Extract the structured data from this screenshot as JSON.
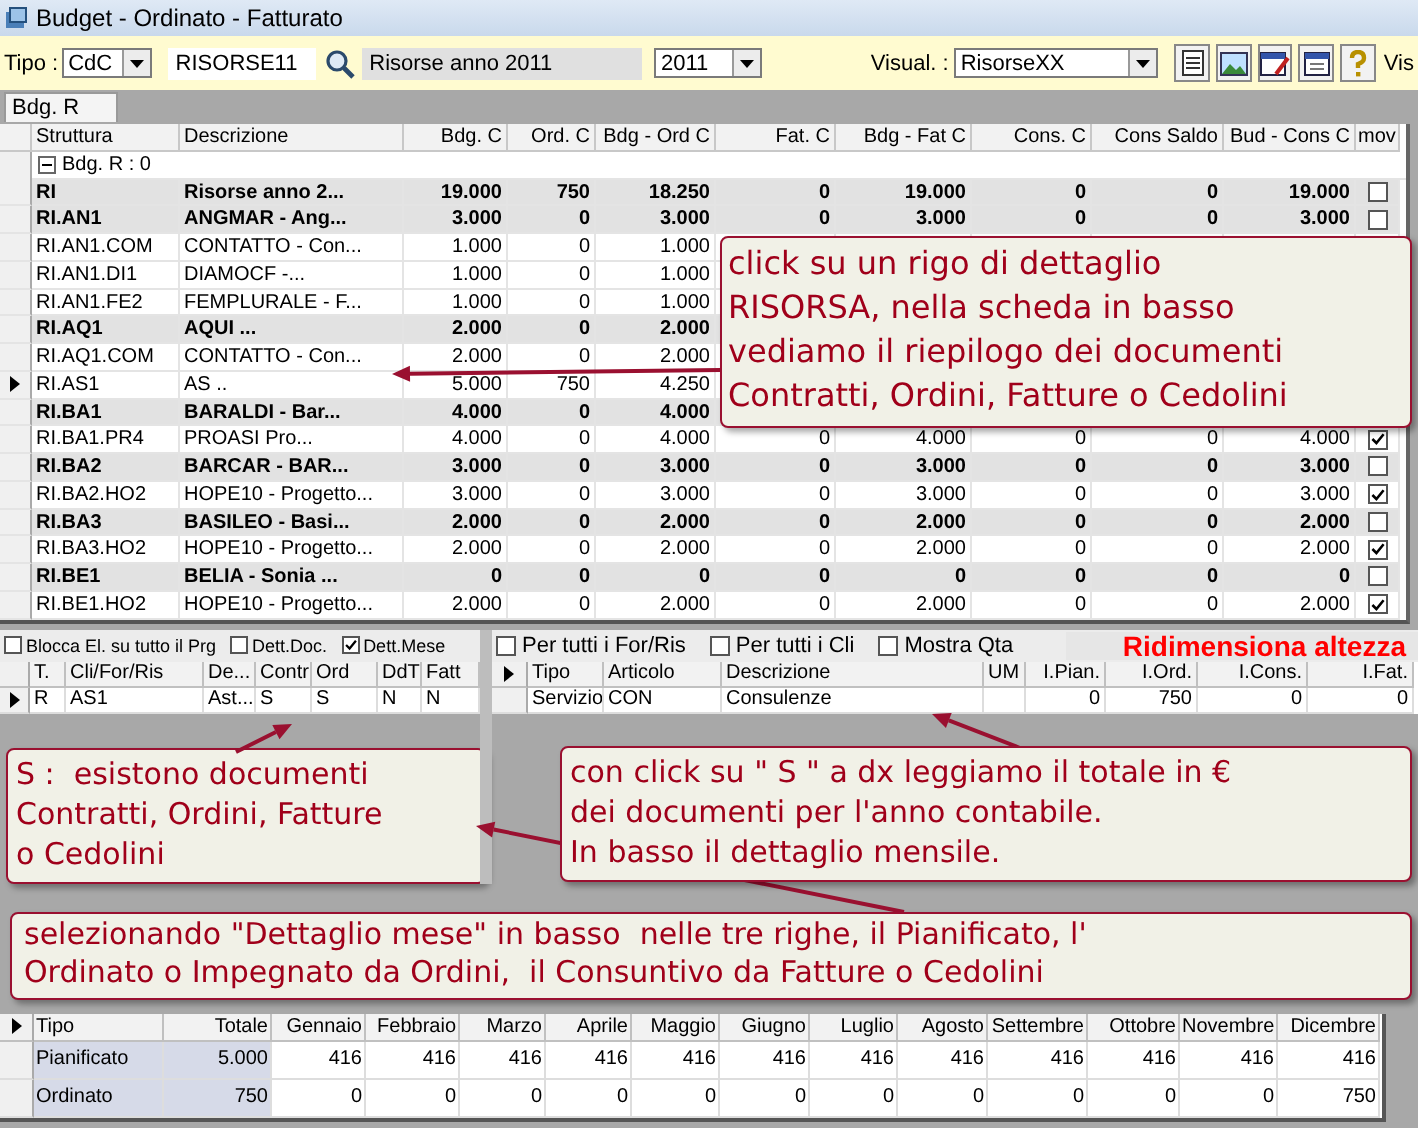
{
  "window": {
    "title": "Budget - Ordinato - Fatturato"
  },
  "toolbar": {
    "tipo_label": "Tipo :",
    "tipo": "CdC",
    "code": "RISORSE11",
    "description": "Risorse anno 2011",
    "year": "2011",
    "visual_label": "Visual. :",
    "visual": "RisorseXX",
    "cut_label": "Vis"
  },
  "tabs": [
    {
      "label": "Bdg. R",
      "selected": true
    }
  ],
  "grid": {
    "columns": [
      "Struttura",
      "Descrizione",
      "Bdg. C",
      "Ord. C",
      "Bdg - Ord C",
      "Fat. C",
      "Bdg - Fat C",
      "Cons. C",
      "Cons Saldo",
      "Bud - Cons C",
      "mov"
    ],
    "group": {
      "label": "Bdg. R : 0",
      "expanded": true
    },
    "rows": [
      {
        "kind": "group",
        "selected": false,
        "code": "RI",
        "description": "Risorse anno 2...",
        "values": [
          "19.000",
          "750",
          "18.250",
          "0",
          "19.000",
          "0",
          "0",
          "19.000"
        ],
        "mov": false
      },
      {
        "kind": "group",
        "selected": false,
        "code": "RI.AN1",
        "description": "ANGMAR - Ang...",
        "values": [
          "3.000",
          "0",
          "3.000",
          "0",
          "3.000",
          "0",
          "0",
          "3.000"
        ],
        "mov": false
      },
      {
        "kind": "detail",
        "selected": false,
        "code": "RI.AN1.COM",
        "description": "CONTATTO - Con...",
        "values": [
          "1.000",
          "0",
          "1.000"
        ]
      },
      {
        "kind": "detail",
        "selected": false,
        "code": "RI.AN1.DI1",
        "description": "DIAMOCF -...",
        "values": [
          "1.000",
          "0",
          "1.000"
        ]
      },
      {
        "kind": "detail",
        "selected": false,
        "code": "RI.AN1.FE2",
        "description": "FEMPLURALE - F...",
        "values": [
          "1.000",
          "0",
          "1.000"
        ]
      },
      {
        "kind": "group",
        "selected": false,
        "code": "RI.AQ1",
        "description": "AQUI ...",
        "values": [
          "2.000",
          "0",
          "2.000"
        ]
      },
      {
        "kind": "detail",
        "selected": false,
        "code": "RI.AQ1.COM",
        "description": "CONTATTO - Con...",
        "values": [
          "2.000",
          "0",
          "2.000"
        ]
      },
      {
        "kind": "detail",
        "selected": true,
        "code": "RI.AS1",
        "description": "AS ..",
        "values": [
          "5.000",
          "750",
          "4.250"
        ]
      },
      {
        "kind": "group",
        "selected": false,
        "code": "RI.BA1",
        "description": "BARALDI - Bar...",
        "values": [
          "4.000",
          "0",
          "4.000"
        ]
      },
      {
        "kind": "detail",
        "selected": false,
        "code": "RI.BA1.PR4",
        "description": "PROASI Pro...",
        "values": [
          "4.000",
          "0",
          "4.000",
          "0",
          "4.000",
          "0",
          "0",
          "4.000"
        ],
        "mov": true
      },
      {
        "kind": "group",
        "selected": false,
        "code": "RI.BA2",
        "description": "BARCAR - BAR...",
        "values": [
          "3.000",
          "0",
          "3.000",
          "0",
          "3.000",
          "0",
          "0",
          "3.000"
        ],
        "mov": false
      },
      {
        "kind": "detail",
        "selected": false,
        "code": "RI.BA2.HO2",
        "description": "HOPE10 - Progetto...",
        "values": [
          "3.000",
          "0",
          "3.000",
          "0",
          "3.000",
          "0",
          "0",
          "3.000"
        ],
        "mov": true
      },
      {
        "kind": "group",
        "selected": false,
        "code": "RI.BA3",
        "description": "BASILEO - Basi...",
        "values": [
          "2.000",
          "0",
          "2.000",
          "0",
          "2.000",
          "0",
          "0",
          "2.000"
        ],
        "mov": false
      },
      {
        "kind": "detail",
        "selected": false,
        "code": "RI.BA3.HO2",
        "description": "HOPE10 - Progetto...",
        "values": [
          "2.000",
          "0",
          "2.000",
          "0",
          "2.000",
          "0",
          "0",
          "2.000"
        ],
        "mov": true
      },
      {
        "kind": "group",
        "selected": false,
        "code": "RI.BE1",
        "description": "BELIA - Sonia ...",
        "values": [
          "0",
          "0",
          "0",
          "0",
          "0",
          "0",
          "0",
          "0"
        ],
        "mov": false
      },
      {
        "kind": "detail",
        "selected": false,
        "code": "RI.BE1.HO2",
        "description": "HOPE10 - Progetto...",
        "values": [
          "2.000",
          "0",
          "2.000",
          "0",
          "2.000",
          "0",
          "0",
          "2.000"
        ],
        "mov": true
      }
    ],
    "callout": "click su un rigo di dettaglio\nRISORSA, nella scheda in basso\nvediamo il riepilogo dei documenti\nContratti, Ordini, Fatture o Cedolini"
  },
  "left_panel": {
    "options": [
      {
        "label": "Blocca El. su tutto il Prg",
        "checked": false
      },
      {
        "label": "Dett.Doc.",
        "checked": false
      },
      {
        "label": "Dett.Mese",
        "checked": true
      }
    ],
    "columns": [
      "T.",
      "Cli/For/Ris",
      "De...",
      "Contr",
      "Ord",
      "DdT",
      "Fatt"
    ],
    "rows": [
      {
        "selected": true,
        "cells": [
          "R",
          "AS1",
          "Ast...",
          "S",
          "S",
          "N",
          "N"
        ]
      }
    ],
    "callout": "S :  esistono documenti\nContratti, Ordini, Fatture\no Cedolini"
  },
  "right_panel": {
    "options": [
      {
        "label": "Per tutti i For/Ris",
        "checked": false
      },
      {
        "label": "Per tutti i Cli",
        "checked": false
      },
      {
        "label": "Mostra Qta",
        "checked": false
      }
    ],
    "resize_link": "Ridimensiona altezza",
    "header_pointer": true,
    "columns": [
      "Tipo",
      "Articolo",
      "Descrizione",
      "UM",
      "I.Pian.",
      "I.Ord.",
      "I.Cons.",
      "I.Fat."
    ],
    "rows": [
      {
        "selected": false,
        "cells": [
          "Servizio",
          "CON",
          "Consulenze",
          null,
          "0",
          "750",
          "0",
          "0"
        ]
      }
    ],
    "callout": "con click su \" S \" a dx leggiamo il totale in €\ndei documenti per l'anno contabile.\nIn basso il dettaglio mensile."
  },
  "footer_callout": "selezionando \"Dettaglio mese\" in basso  nelle tre righe, il Pianificato, l'\nOrdinato o Impegnato da Ordini,  il Consuntivo da Fatture o Cedolini",
  "monthly": {
    "header_pointer": true,
    "columns": [
      "Tipo",
      "Totale",
      "Gennaio",
      "Febbraio",
      "Marzo",
      "Aprile",
      "Maggio",
      "Giugno",
      "Luglio",
      "Agosto",
      "Settembre",
      "Ottobre",
      "Novembre",
      "Dicembre"
    ],
    "rows": [
      {
        "selected": false,
        "cells": [
          "Pianificato",
          "5.000",
          "416",
          "416",
          "416",
          "416",
          "416",
          "416",
          "416",
          "416",
          "416",
          "416",
          "416",
          "416"
        ]
      },
      {
        "selected": false,
        "cells": [
          "Ordinato",
          "750",
          "0",
          "0",
          "0",
          "0",
          "0",
          "0",
          "0",
          "0",
          "0",
          "0",
          "0",
          "750"
        ]
      }
    ]
  }
}
